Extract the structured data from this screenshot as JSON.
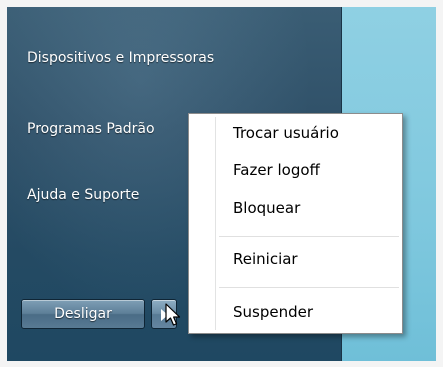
{
  "start_menu": {
    "items": [
      {
        "label": "Dispositivos e Impressoras"
      },
      {
        "label": "Programas Padrão"
      },
      {
        "label": "Ajuda e Suporte"
      }
    ],
    "shutdown_label": "Desligar"
  },
  "context_menu": {
    "items": [
      {
        "label": "Trocar usuário"
      },
      {
        "label": "Fazer logoff"
      },
      {
        "label": "Bloquear"
      },
      {
        "label": "Reiniciar"
      },
      {
        "label": "Suspender"
      }
    ]
  }
}
